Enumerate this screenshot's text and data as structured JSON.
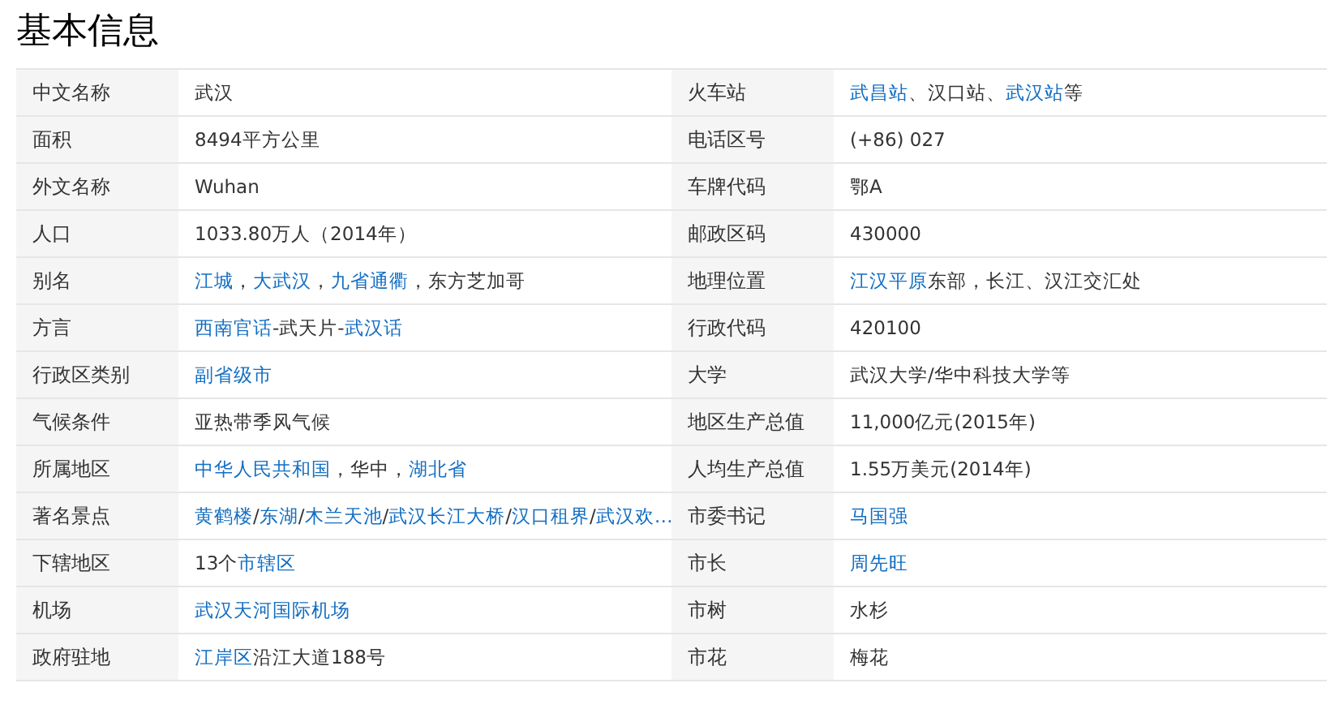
{
  "title": "基本信息",
  "rows": [
    {
      "pairs": [
        {
          "label": "中文名称",
          "value": [
            {
              "text": "武汉",
              "link": false
            }
          ]
        },
        {
          "label": "火车站",
          "value": [
            {
              "text": "武昌站",
              "link": true
            },
            {
              "text": "、汉口站、",
              "link": false
            },
            {
              "text": "武汉站",
              "link": true
            },
            {
              "text": "等",
              "link": false
            }
          ]
        }
      ]
    },
    {
      "pairs": [
        {
          "label": "面积",
          "value": [
            {
              "text": "8494平方公里",
              "link": false
            }
          ]
        },
        {
          "label": "电话区号",
          "value": [
            {
              "text": "(+86) 027",
              "link": false
            }
          ]
        }
      ]
    },
    {
      "pairs": [
        {
          "label": "外文名称",
          "value": [
            {
              "text": "Wuhan",
              "link": false
            }
          ]
        },
        {
          "label": "车牌代码",
          "value": [
            {
              "text": "鄂A",
              "link": false
            }
          ]
        }
      ]
    },
    {
      "pairs": [
        {
          "label": "人口",
          "value": [
            {
              "text": "1033.80万人（2014年）",
              "link": false
            }
          ]
        },
        {
          "label": "邮政区码",
          "value": [
            {
              "text": "430000",
              "link": false
            }
          ]
        }
      ]
    },
    {
      "pairs": [
        {
          "label": "别名",
          "value": [
            {
              "text": "江城",
              "link": true
            },
            {
              "text": "，",
              "link": false
            },
            {
              "text": "大武汉",
              "link": true
            },
            {
              "text": "，",
              "link": false
            },
            {
              "text": "九省通衢",
              "link": true
            },
            {
              "text": "，东方芝加哥",
              "link": false
            }
          ]
        },
        {
          "label": "地理位置",
          "value": [
            {
              "text": "江汉平原",
              "link": true
            },
            {
              "text": "东部，长江、汉江交汇处",
              "link": false
            }
          ]
        }
      ]
    },
    {
      "pairs": [
        {
          "label": "方言",
          "value": [
            {
              "text": "西南官话",
              "link": true
            },
            {
              "text": "-武天片-",
              "link": false
            },
            {
              "text": "武汉话",
              "link": true
            }
          ]
        },
        {
          "label": "行政代码",
          "value": [
            {
              "text": "420100",
              "link": false
            }
          ]
        }
      ]
    },
    {
      "pairs": [
        {
          "label": "行政区类别",
          "value": [
            {
              "text": "副省级市",
              "link": true
            }
          ]
        },
        {
          "label": "大学",
          "value": [
            {
              "text": "武汉大学/华中科技大学等",
              "link": false
            }
          ]
        }
      ]
    },
    {
      "pairs": [
        {
          "label": "气候条件",
          "value": [
            {
              "text": "亚热带季风气候",
              "link": false
            }
          ]
        },
        {
          "label": "地区生产总值",
          "value": [
            {
              "text": "11,000亿元(2015年)",
              "link": false
            }
          ]
        }
      ]
    },
    {
      "pairs": [
        {
          "label": "所属地区",
          "value": [
            {
              "text": "中华人民共和国",
              "link": true
            },
            {
              "text": "，华中，",
              "link": false
            },
            {
              "text": "湖北省",
              "link": true
            }
          ]
        },
        {
          "label": "人均生产总值",
          "value": [
            {
              "text": "1.55万美元(2014年)",
              "link": false
            }
          ]
        }
      ]
    },
    {
      "pairs": [
        {
          "label": "著名景点",
          "value": [
            {
              "text": "黄鹤楼",
              "link": true
            },
            {
              "text": "/",
              "link": false
            },
            {
              "text": "东湖",
              "link": true
            },
            {
              "text": "/",
              "link": false
            },
            {
              "text": "木兰天池",
              "link": true
            },
            {
              "text": "/",
              "link": false
            },
            {
              "text": "武汉长江大桥",
              "link": true
            },
            {
              "text": "/",
              "link": false
            },
            {
              "text": "汉口租界",
              "link": true
            },
            {
              "text": "/",
              "link": false
            },
            {
              "text": "武汉欢…",
              "link": true
            }
          ]
        },
        {
          "label": "市委书记",
          "value": [
            {
              "text": "马国强",
              "link": true
            }
          ]
        }
      ]
    },
    {
      "pairs": [
        {
          "label": "下辖地区",
          "value": [
            {
              "text": "13个",
              "link": false
            },
            {
              "text": "市辖区",
              "link": true
            }
          ]
        },
        {
          "label": "市长",
          "value": [
            {
              "text": "周先旺",
              "link": true
            }
          ]
        }
      ]
    },
    {
      "pairs": [
        {
          "label": "机场",
          "value": [
            {
              "text": "武汉天河国际机场",
              "link": true
            }
          ]
        },
        {
          "label": "市树",
          "value": [
            {
              "text": "水杉",
              "link": false
            }
          ]
        }
      ]
    },
    {
      "pairs": [
        {
          "label": "政府驻地",
          "value": [
            {
              "text": "江岸区",
              "link": true
            },
            {
              "text": "沿江大道188号",
              "link": false
            }
          ]
        },
        {
          "label": "市花",
          "value": [
            {
              "text": "梅花",
              "link": false
            }
          ]
        }
      ]
    }
  ]
}
